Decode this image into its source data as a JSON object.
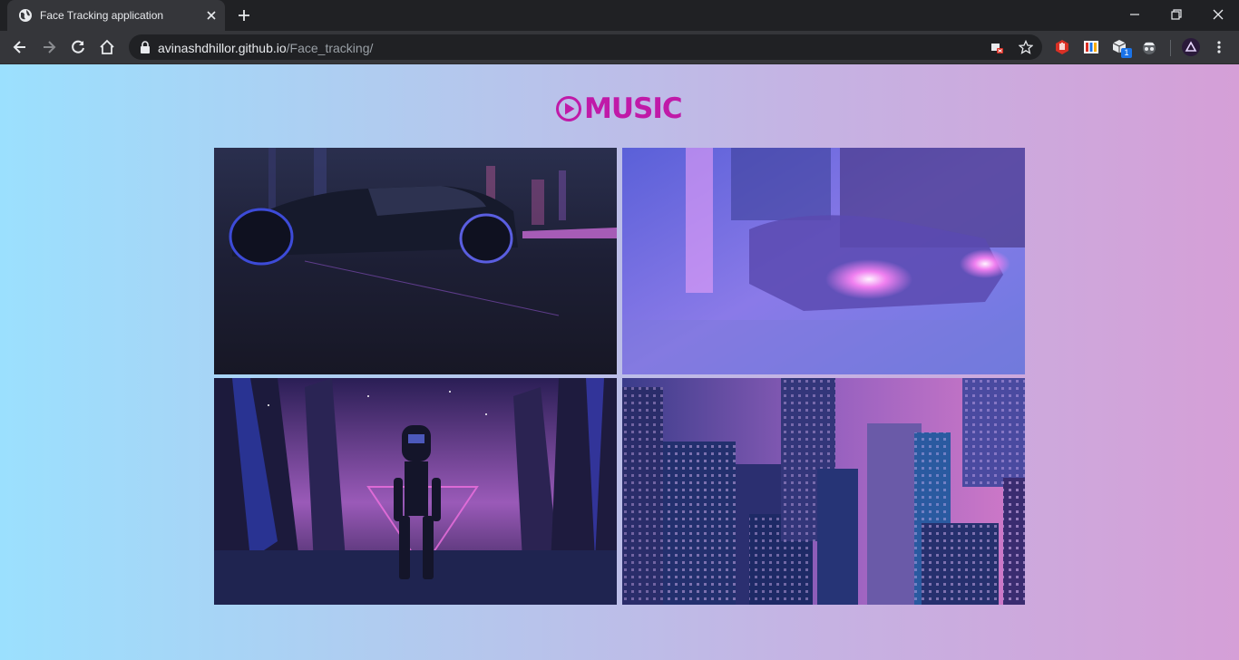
{
  "browser": {
    "tab_title": "Face Tracking application",
    "url_host": "avinashdhillor.github.io",
    "url_path": "/Face_tracking/",
    "extension_badge": "1"
  },
  "page": {
    "logo_text": "MUSIC",
    "colors": {
      "gradient_left": "#9be0fe",
      "gradient_right": "#d59fd7",
      "logo": "#c01aa8"
    },
    "tiles": [
      {
        "icon": "neon-car-dark-image"
      },
      {
        "icon": "neon-car-headlights-image"
      },
      {
        "icon": "robot-neon-canyon-image"
      },
      {
        "icon": "night-city-skyline-image"
      }
    ]
  }
}
